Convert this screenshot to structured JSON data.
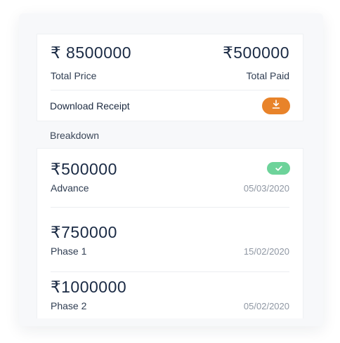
{
  "summary": {
    "total_price_value": "₹ 8500000",
    "total_price_label": "Total Price",
    "total_paid_value": "₹500000",
    "total_paid_label": "Total Paid",
    "download_label": "Download Receipt",
    "download_icon": "download-icon"
  },
  "breakdown": {
    "title": "Breakdown",
    "items": [
      {
        "amount": "₹500000",
        "label": "Advance",
        "date": "05/03/2020",
        "status_icon": "check-icon"
      },
      {
        "amount": "₹750000",
        "label": "Phase 1",
        "date": "15/02/2020"
      },
      {
        "amount": "₹1000000",
        "label": "Phase 2",
        "date": "05/02/2020"
      }
    ]
  },
  "colors": {
    "accent_orange": "#e8832a",
    "paid_green": "#6dd39a",
    "text_dark": "#1a2a44",
    "text_muted": "#8f97a3"
  }
}
